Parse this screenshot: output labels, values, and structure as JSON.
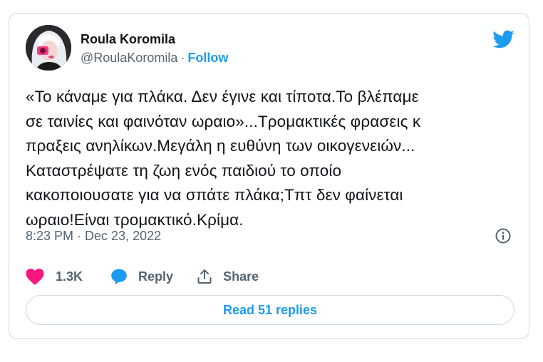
{
  "tweet": {
    "author": {
      "display_name": "Roula Koromila",
      "handle": "@RoulaKoromila",
      "separator": "·",
      "follow_label": "Follow"
    },
    "text": "«Το κάναμε για πλάκα. Δεν έγινε και τίποτα.Το βλέπαμε\nσε ταινίες και φαινόταν ωραιο»...Τρομακτικές φρασεις κ\nπραξεις ανηλίκων.Μεγάλη η ευθύνη των οικογενειών...\nΚαταστρέψατε τη ζωη ενός παιδιού το οποίο\nκακοποιουσατε για να σπάτε πλάκα;Τπτ δεν φαίνεται\nωραιο!Είναι τρομακτικό.Κρίμα.",
    "time": "8:23 PM",
    "date_separator": "·",
    "date": "Dec 23, 2022",
    "actions": {
      "like_count": "1.3K",
      "reply_label": "Reply",
      "share_label": "Share"
    },
    "read_replies_label": "Read 51 replies"
  },
  "colors": {
    "brand_blue": "#1d9bf0",
    "like_pink": "#f91880",
    "text_primary": "#0f1419",
    "text_secondary": "#536471",
    "border": "#cfd9de"
  },
  "icons": {
    "brand": "twitter-bird-icon",
    "info": "info-icon",
    "like": "heart-icon",
    "reply": "speech-bubble-icon",
    "share": "share-upload-icon"
  }
}
